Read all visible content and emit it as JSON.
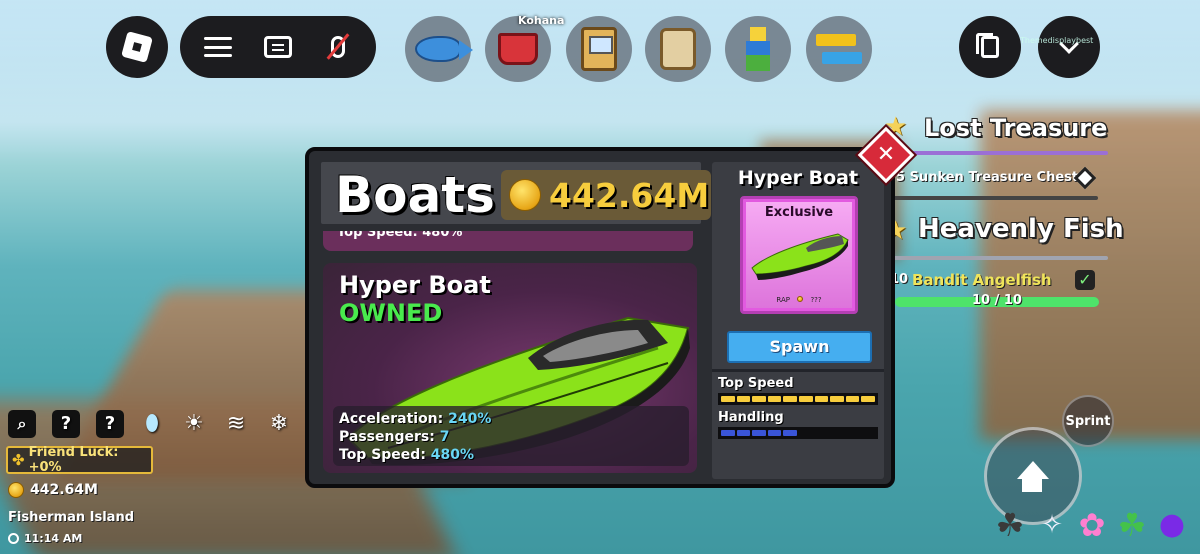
{
  "topbar": {
    "shop_label": "Kohana",
    "player_name_small": "Themedisplaybest",
    "icons": [
      "roblox-logo-icon",
      "menu-icon",
      "chat-icon",
      "mic-muted-icon",
      "fish-icon",
      "basket-icon",
      "arcade-icon",
      "scroll-icon",
      "avatar-icon",
      "trade-icon",
      "copy-icon",
      "chevron-down-icon"
    ]
  },
  "quests": {
    "lost_treasure": {
      "title": "Lost Treasure",
      "task": "5 Sunken Treasure Chests!"
    },
    "heavenly_fish": {
      "title": "Heavenly Fish",
      "task_prefix": "10",
      "task": "Bandit Angelfish",
      "progress_text": "10 / 10",
      "progress": 1.0
    }
  },
  "status": {
    "friend_luck": "Friend Luck: +0%",
    "money": "442.64M",
    "location": "Fisherman Island",
    "time": "11:14 AM",
    "icons": [
      "magnifier-icon",
      "unknown-icon",
      "unknown-icon",
      "crystal-icon",
      "sun-icon",
      "wind-icon",
      "snowflake-icon"
    ],
    "unknown_glyph": "?"
  },
  "panel": {
    "title": "Boats",
    "money": "442.64M",
    "previous_card_text": "Top Speed: 480%",
    "boat": {
      "name": "Hyper Boat",
      "status": "OWNED",
      "acceleration_label": "Acceleration:",
      "acceleration": "240%",
      "passengers_label": "Passengers:",
      "passengers": "7",
      "top_speed_label": "Top Speed:",
      "top_speed": "480%"
    },
    "side": {
      "name": "Hyper Boat",
      "badge": "Exclusive",
      "rap_label": "RAP",
      "rap_value": "???",
      "spawn_label": "Spawn",
      "top_speed_label": "Top Speed",
      "top_speed_rating": 1.0,
      "handling_label": "Handling",
      "handling_rating": 0.45
    },
    "close_glyph": "✕"
  },
  "controls": {
    "sprint_label": "Sprint"
  },
  "colors": {
    "accent_gold": "#f7cd3d",
    "owned_green": "#49ea4d",
    "spawn_blue": "#45aef0",
    "close_red": "#d72a3a",
    "thumb_pink": "#e25ae0"
  }
}
